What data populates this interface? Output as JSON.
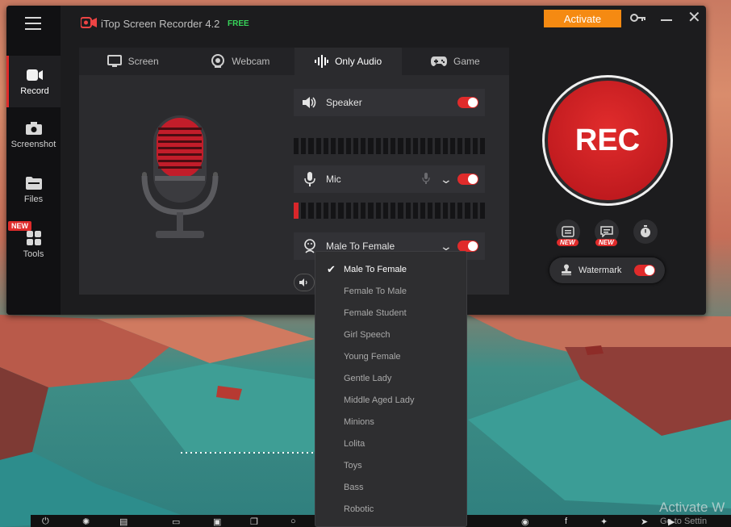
{
  "app": {
    "title": "iTop Screen Recorder 4.2",
    "edition": "FREE",
    "activate_label": "Activate"
  },
  "sidebar": {
    "items": [
      {
        "label": "Record",
        "icon": "record-icon"
      },
      {
        "label": "Screenshot",
        "icon": "camera-icon"
      },
      {
        "label": "Files",
        "icon": "folder-icon"
      },
      {
        "label": "Tools",
        "icon": "tools-grid-icon",
        "badge": "NEW"
      }
    ]
  },
  "tabs": [
    {
      "label": "Screen",
      "icon": "monitor-icon"
    },
    {
      "label": "Webcam",
      "icon": "webcam-icon"
    },
    {
      "label": "Only Audio",
      "icon": "audio-wave-icon"
    },
    {
      "label": "Game",
      "icon": "gamepad-icon"
    }
  ],
  "audio": {
    "speaker_label": "Speaker",
    "mic_label": "Mic",
    "voice_changer_label": "Male To Female"
  },
  "rec": {
    "label": "REC",
    "new_badge": "NEW",
    "watermark_label": "Watermark"
  },
  "voice_options": {
    "items": [
      "Male To Female",
      "Female To Male",
      "Female Student",
      "Girl Speech",
      "Young Female",
      "Gentle Lady",
      "Middle Aged Lady",
      "Minions",
      "Lolita",
      "Toys",
      "Bass",
      "Robotic"
    ],
    "selected": "Male To Female"
  },
  "desktop": {
    "watermark_line1": "Activate W",
    "watermark_line2": "Go to Settin"
  },
  "colors": {
    "accent": "#e02b2b",
    "activate": "#f58a12",
    "free": "#37d45a"
  }
}
